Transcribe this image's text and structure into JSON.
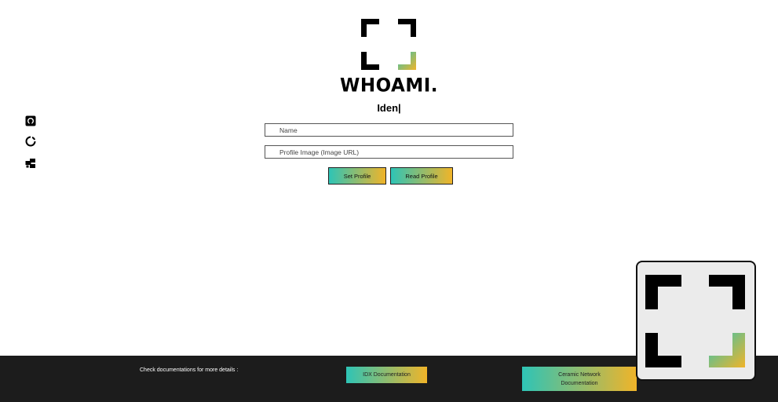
{
  "brand": {
    "name": "WHOAMI.",
    "typing_text": "Iden|"
  },
  "sidebar": {
    "icons": [
      "github-icon",
      "loading-ring-icon",
      "network-icon"
    ]
  },
  "form": {
    "name_placeholder": "Name",
    "image_placeholder": "Profile Image (Image URL)",
    "set_label": "Set Profile",
    "read_label": "Read Profile"
  },
  "footer": {
    "note": "Check documentations for more details :",
    "idx_label": "IDX Documentation",
    "ceramic_label": "Ceramic Network Documentation"
  },
  "colors": {
    "gradient_start": "#2ec4b6",
    "gradient_end": "#f0b429",
    "footer_bg": "#1c1c1c"
  }
}
